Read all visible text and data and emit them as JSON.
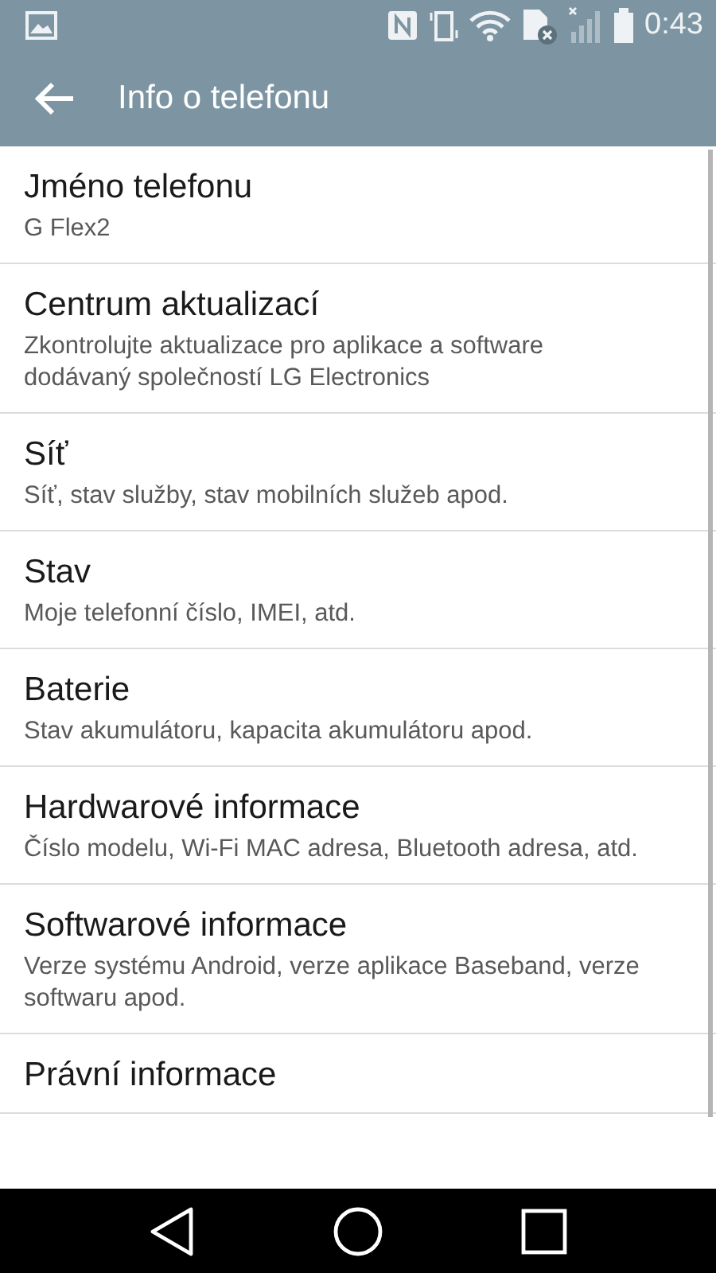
{
  "status_bar": {
    "time": "0:43"
  },
  "app_bar": {
    "title": "Info o telefonu"
  },
  "items": [
    {
      "title": "Jméno telefonu",
      "subtitle": "G Flex2"
    },
    {
      "title": "Centrum aktualizací",
      "subtitle": "Zkontrolujte aktualizace pro aplikace a software dodávaný společností LG Electronics"
    },
    {
      "title": "Síť",
      "subtitle": "Síť, stav služby, stav mobilních služeb apod."
    },
    {
      "title": "Stav",
      "subtitle": "Moje telefonní číslo, IMEI, atd."
    },
    {
      "title": "Baterie",
      "subtitle": "Stav akumulátoru, kapacita akumulátoru apod."
    },
    {
      "title": "Hardwarové informace",
      "subtitle": "Číslo modelu, Wi-Fi MAC adresa, Bluetooth adresa, atd."
    },
    {
      "title": "Softwarové informace",
      "subtitle": "Verze systému Android, verze aplikace Baseband, verze softwaru apod."
    },
    {
      "title": "Právní informace"
    }
  ]
}
